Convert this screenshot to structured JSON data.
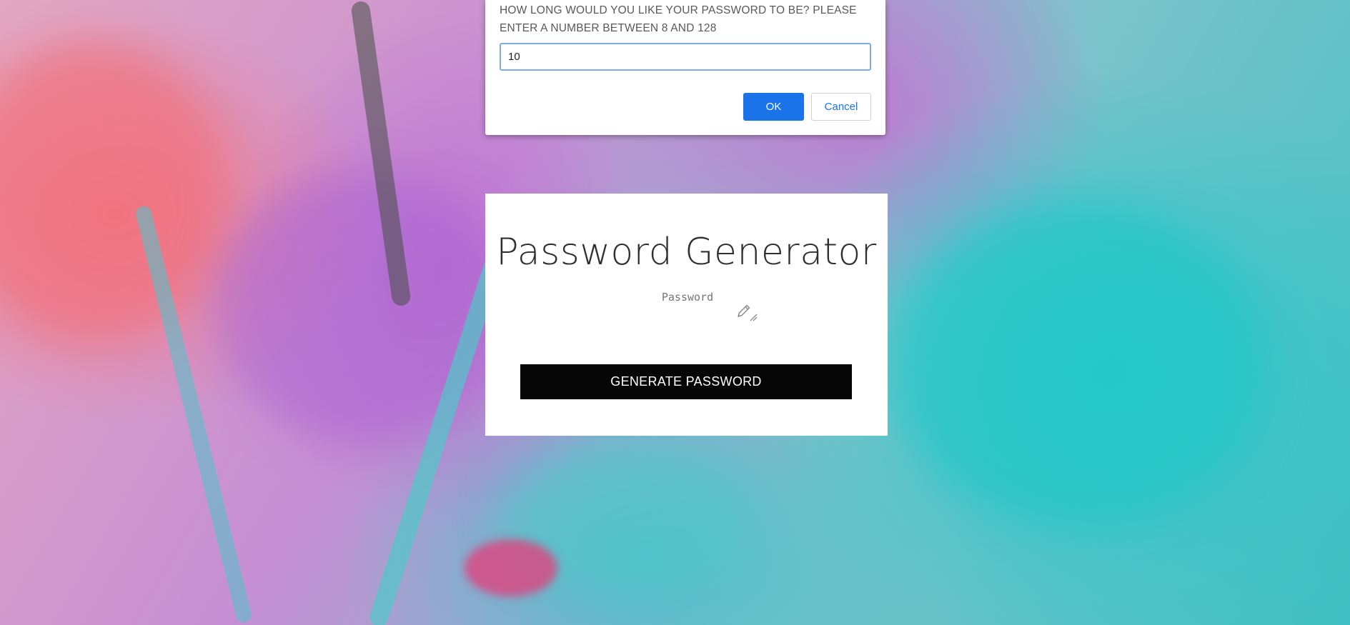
{
  "dialog": {
    "message": "HOW LONG WOULD YOU LIKE YOUR PASSWORD TO BE? PLEASE ENTER A NUMBER BETWEEN 8 AND 128",
    "input_value": "10",
    "ok_label": "OK",
    "cancel_label": "Cancel"
  },
  "card": {
    "title": "Password Generator",
    "password_placeholder": "Password",
    "generate_label": "GENERATE PASSWORD"
  },
  "colors": {
    "accent": "#1a73e8",
    "button_dark": "#060606"
  },
  "icons": {
    "edit": "pencil-icon",
    "resize": "resize-grip-icon"
  }
}
